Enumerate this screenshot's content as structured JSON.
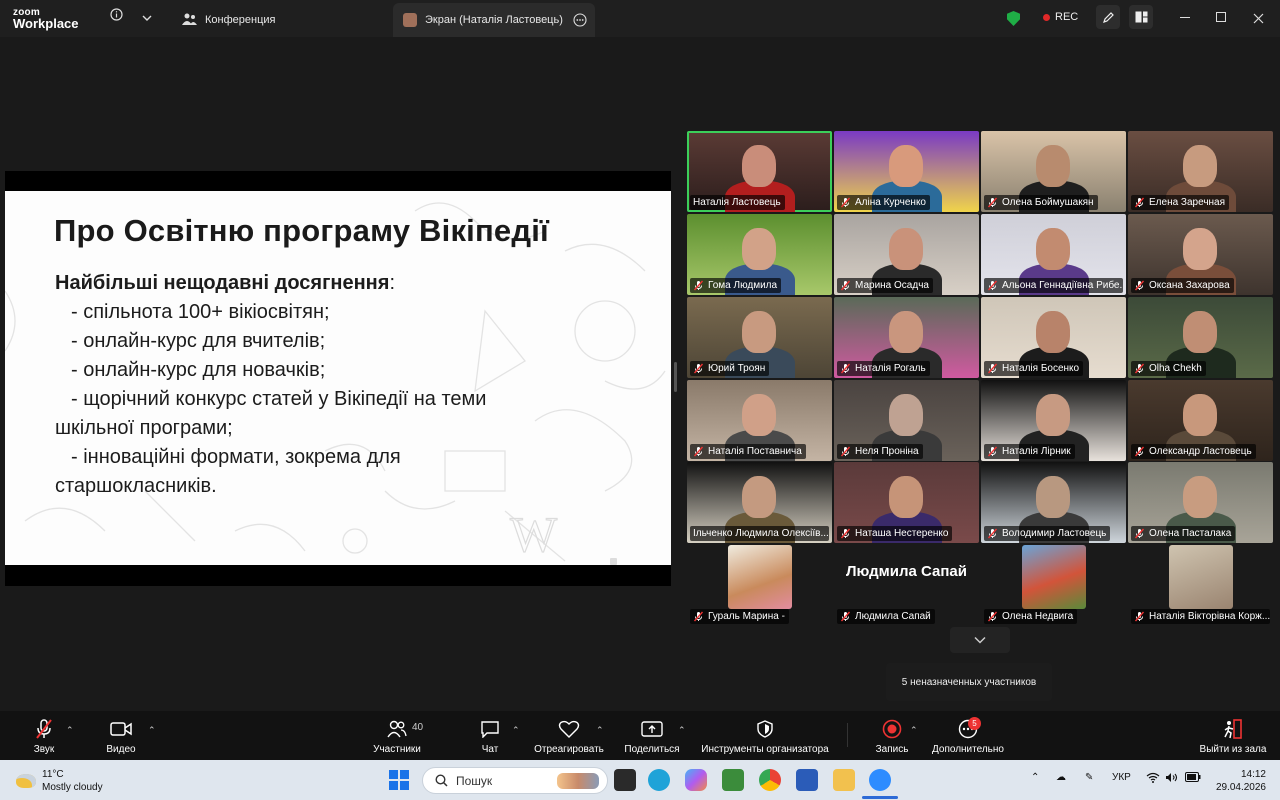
{
  "titlebar": {
    "logo_top": "zoom",
    "logo_bottom": "Workplace",
    "tabs": [
      {
        "label": "Конференция"
      },
      {
        "label": "Экран (Наталія Ластовець)"
      }
    ],
    "rec_label": "REC"
  },
  "slide": {
    "title": "Про Освітню програму Вікіпедії",
    "subtitle": "Найбільші нещодавні досягнення",
    "subtitle_suffix": ":",
    "lines": [
      "- спільнота 100+ вікіосвітян;",
      "- онлайн-курс для вчителів;",
      "- онлайн-курс для новачків;",
      "- щорічний конкурс статей у Вікіпедії на теми",
      "шкільної програми;",
      "- інноваційні формати, зокрема для",
      "старшокласників."
    ]
  },
  "participants": [
    {
      "name": "Наталія Ластовець",
      "muted": false
    },
    {
      "name": "Аліна Курченко",
      "muted": true
    },
    {
      "name": "Олена Боймушакян",
      "muted": true
    },
    {
      "name": "Елена Заречная",
      "muted": true
    },
    {
      "name": "Гома Людмила",
      "muted": true
    },
    {
      "name": "Марина Осадча",
      "muted": true
    },
    {
      "name": "Альона Геннадіївна Рибе...",
      "muted": true
    },
    {
      "name": "Оксана Захарова",
      "muted": true
    },
    {
      "name": "Юрий Троян",
      "muted": true
    },
    {
      "name": "Наталія Рогаль",
      "muted": true
    },
    {
      "name": "Наталія Босенко",
      "muted": true
    },
    {
      "name": "Olha Chekh",
      "muted": true
    },
    {
      "name": "Наталія Поставнича",
      "muted": true
    },
    {
      "name": "Неля Проніна",
      "muted": true
    },
    {
      "name": "Наталія Лірник",
      "muted": true
    },
    {
      "name": "Олександр Ластовець",
      "muted": true
    },
    {
      "name": "Ільченко Людмила Олексіїв...",
      "muted": false
    },
    {
      "name": "Наташа Нестеренко",
      "muted": true
    },
    {
      "name": "Володимир Ластовець",
      "muted": true
    },
    {
      "name": "Олена Пасталака",
      "muted": true
    },
    {
      "name": "Гураль Марина -",
      "muted": true
    },
    {
      "name": "Людмила Сапай",
      "muted": true,
      "big_name": "Людмила Сапай"
    },
    {
      "name": "Олена Недвига",
      "muted": true
    },
    {
      "name": "Наталія Вікторівна Корж...",
      "muted": true
    }
  ],
  "tooltip": "5 неназначенных участников",
  "toolbar": {
    "audio": "Звук",
    "video": "Видео",
    "participants": "Участники",
    "participants_count": "40",
    "chat": "Чат",
    "react": "Отреагировать",
    "share": "Поделиться",
    "host_tools": "Инструменты организатора",
    "record": "Запись",
    "more": "Дополнительно",
    "more_badge": "5",
    "leave": "Выйти из зала"
  },
  "taskbar": {
    "temp": "11°C",
    "weather": "Mostly cloudy",
    "search_placeholder": "Пошук",
    "lang": "УКР",
    "time": "14:12",
    "date": "29.04.2026"
  },
  "colors": {
    "active_speaker": "#3ccf5a",
    "rec": "#e02828",
    "leave": "#e33b3b",
    "badge": "#e33333"
  }
}
